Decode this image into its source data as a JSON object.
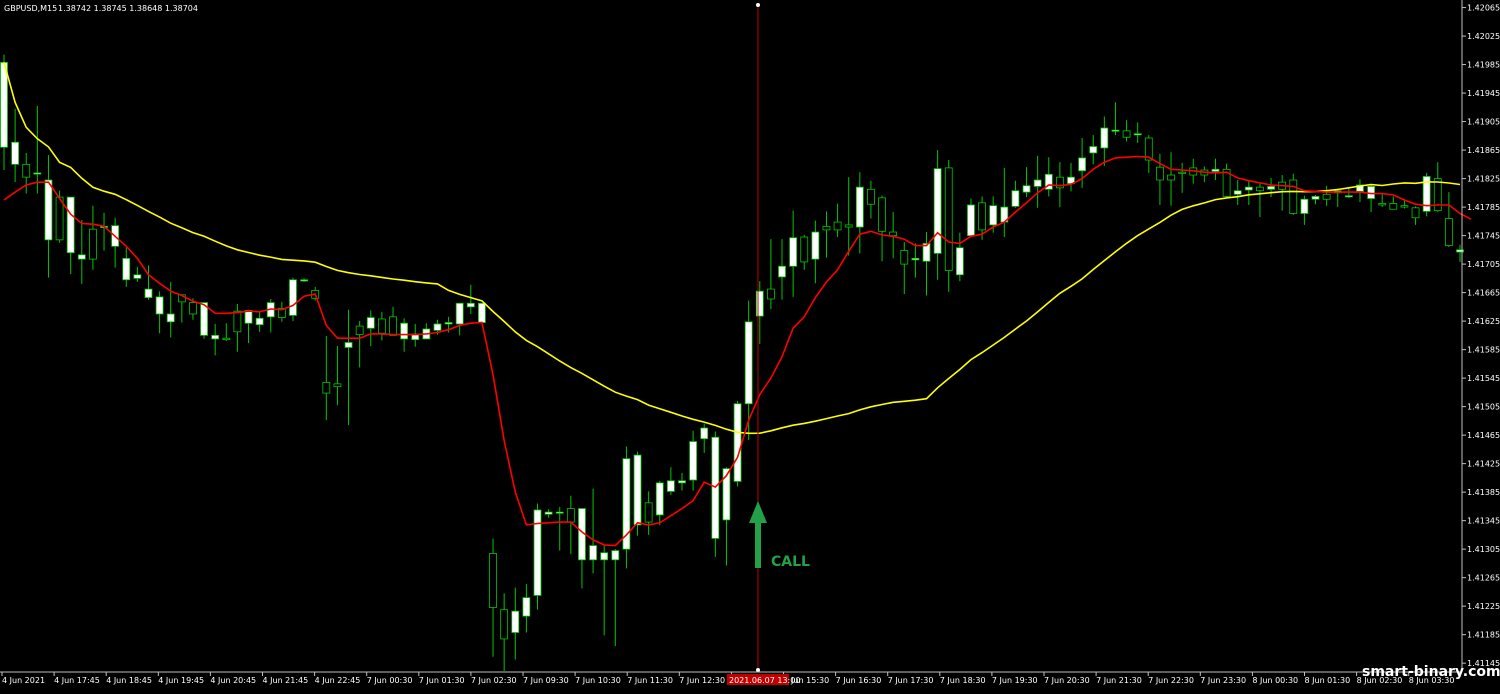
{
  "header": {
    "symbol": "GBPUSD,M15",
    "quotes": "1.38742 1.38745 1.38648 1.38704"
  },
  "watermark": "smart-binary.com",
  "signal": {
    "label": "CALL",
    "color": "#24a148"
  },
  "cursor_time_label": "2021.06.07 13:00",
  "colors": {
    "background": "#000000",
    "axis": "#c0c0c0",
    "candle_wick": "#00c800",
    "candle_bull": "#ffffff",
    "candle_bear": "#000000",
    "fast_ma": "#ff0000",
    "slow_ma": "#ffff00",
    "cursor": "#c00000"
  },
  "chart_data": {
    "type": "candlestick",
    "title": "",
    "y_ticks": [
      "1.42065",
      "1.42025",
      "1.41985",
      "1.41945",
      "1.41905",
      "1.41865",
      "1.41825",
      "1.41785",
      "1.41745",
      "1.41705",
      "1.41665",
      "1.41625",
      "1.41585",
      "1.41545",
      "1.41505",
      "1.41465",
      "1.41425",
      "1.41385",
      "1.41345",
      "1.41305",
      "1.41265",
      "1.41225",
      "1.41185",
      "1.41145"
    ],
    "ylim": [
      1.41134,
      1.4207
    ],
    "x_ticks": [
      "4 Jun 2021",
      "4 Jun 17:45",
      "4 Jun 18:45",
      "4 Jun 19:45",
      "4 Jun 20:45",
      "4 Jun 21:45",
      "4 Jun 22:45",
      "7 Jun 00:30",
      "7 Jun 01:30",
      "7 Jun 02:30",
      "7 Jun 09:30",
      "7 Jun 10:30",
      "7 Jun 11:30",
      "7 Jun 12:30",
      "7 Jun 14:30",
      "7 Jun 15:30",
      "7 Jun 16:30",
      "7 Jun 17:30",
      "7 Jun 18:30",
      "7 Jun 19:30",
      "7 Jun 20:30",
      "7 Jun 21:30",
      "7 Jun 22:30",
      "7 Jun 23:30",
      "8 Jun 00:30",
      "8 Jun 01:30",
      "8 Jun 02:30",
      "8 Jun 03:30"
    ],
    "candles": [
      {
        "o": 1.41869,
        "h": 1.41999,
        "l": 1.41837,
        "c": 1.41988
      },
      {
        "o": 1.41845,
        "h": 1.41923,
        "l": 1.4182,
        "c": 1.41876
      },
      {
        "o": 1.41845,
        "h": 1.41861,
        "l": 1.41804,
        "c": 1.41827
      },
      {
        "o": 1.41833,
        "h": 1.41927,
        "l": 1.41804,
        "c": 1.41833
      },
      {
        "o": 1.41739,
        "h": 1.41858,
        "l": 1.41686,
        "c": 1.41823
      },
      {
        "o": 1.41799,
        "h": 1.41808,
        "l": 1.41735,
        "c": 1.41739
      },
      {
        "o": 1.41721,
        "h": 1.41799,
        "l": 1.41691,
        "c": 1.41799
      },
      {
        "o": 1.41712,
        "h": 1.41767,
        "l": 1.41677,
        "c": 1.41718
      },
      {
        "o": 1.41754,
        "h": 1.41787,
        "l": 1.41697,
        "c": 1.41712
      },
      {
        "o": 1.41758,
        "h": 1.41777,
        "l": 1.41724,
        "c": 1.41758
      },
      {
        "o": 1.4173,
        "h": 1.4177,
        "l": 1.417,
        "c": 1.41759
      },
      {
        "o": 1.41683,
        "h": 1.41728,
        "l": 1.41673,
        "c": 1.41713
      },
      {
        "o": 1.41685,
        "h": 1.41701,
        "l": 1.4168,
        "c": 1.4169
      },
      {
        "o": 1.41658,
        "h": 1.41703,
        "l": 1.41655,
        "c": 1.4167
      },
      {
        "o": 1.41635,
        "h": 1.41667,
        "l": 1.41608,
        "c": 1.41659
      },
      {
        "o": 1.41624,
        "h": 1.4168,
        "l": 1.41602,
        "c": 1.41635
      },
      {
        "o": 1.41662,
        "h": 1.41662,
        "l": 1.41623,
        "c": 1.41652
      },
      {
        "o": 1.41651,
        "h": 1.41657,
        "l": 1.41627,
        "c": 1.41635
      },
      {
        "o": 1.41605,
        "h": 1.41647,
        "l": 1.416,
        "c": 1.41651
      },
      {
        "o": 1.416,
        "h": 1.41621,
        "l": 1.41577,
        "c": 1.41605
      },
      {
        "o": 1.41601,
        "h": 1.41622,
        "l": 1.41597,
        "c": 1.41599
      },
      {
        "o": 1.41639,
        "h": 1.41649,
        "l": 1.41582,
        "c": 1.4161
      },
      {
        "o": 1.41622,
        "h": 1.41641,
        "l": 1.41594,
        "c": 1.4164
      },
      {
        "o": 1.4162,
        "h": 1.41639,
        "l": 1.4161,
        "c": 1.41629
      },
      {
        "o": 1.41631,
        "h": 1.41656,
        "l": 1.41609,
        "c": 1.41651
      },
      {
        "o": 1.41643,
        "h": 1.41652,
        "l": 1.41624,
        "c": 1.4163
      },
      {
        "o": 1.41633,
        "h": 1.41686,
        "l": 1.41625,
        "c": 1.41683
      },
      {
        "o": 1.41683,
        "h": 1.41685,
        "l": 1.4168,
        "c": 1.41683
      },
      {
        "o": 1.41668,
        "h": 1.41673,
        "l": 1.41654,
        "c": 1.41657
      },
      {
        "o": 1.41539,
        "h": 1.41604,
        "l": 1.41486,
        "c": 1.41524
      },
      {
        "o": 1.41537,
        "h": 1.4159,
        "l": 1.41507,
        "c": 1.41533
      },
      {
        "o": 1.41588,
        "h": 1.41641,
        "l": 1.41479,
        "c": 1.41595
      },
      {
        "o": 1.41618,
        "h": 1.41625,
        "l": 1.4156,
        "c": 1.41606
      },
      {
        "o": 1.41615,
        "h": 1.4164,
        "l": 1.4159,
        "c": 1.4163
      },
      {
        "o": 1.41628,
        "h": 1.41638,
        "l": 1.41598,
        "c": 1.41608
      },
      {
        "o": 1.41631,
        "h": 1.41645,
        "l": 1.41613,
        "c": 1.41605
      },
      {
        "o": 1.416,
        "h": 1.41629,
        "l": 1.41582,
        "c": 1.41622
      },
      {
        "o": 1.41599,
        "h": 1.41621,
        "l": 1.41589,
        "c": 1.41607
      },
      {
        "o": 1.416,
        "h": 1.41622,
        "l": 1.41602,
        "c": 1.41614
      },
      {
        "o": 1.41612,
        "h": 1.41627,
        "l": 1.41606,
        "c": 1.41621
      },
      {
        "o": 1.41621,
        "h": 1.41631,
        "l": 1.41609,
        "c": 1.41623
      },
      {
        "o": 1.41621,
        "h": 1.41649,
        "l": 1.41605,
        "c": 1.4165
      },
      {
        "o": 1.41645,
        "h": 1.41676,
        "l": 1.41635,
        "c": 1.4165
      },
      {
        "o": 1.41623,
        "h": 1.41648,
        "l": 1.41623,
        "c": 1.4165
      },
      {
        "o": 1.41299,
        "h": 1.4132,
        "l": 1.41154,
        "c": 1.41223
      },
      {
        "o": 1.4122,
        "h": 1.41243,
        "l": 1.41134,
        "c": 1.41179
      },
      {
        "o": 1.41188,
        "h": 1.41251,
        "l": 1.4115,
        "c": 1.41218
      },
      {
        "o": 1.41211,
        "h": 1.41256,
        "l": 1.41188,
        "c": 1.41237
      },
      {
        "o": 1.4124,
        "h": 1.41369,
        "l": 1.4122,
        "c": 1.4136
      },
      {
        "o": 1.41354,
        "h": 1.41361,
        "l": 1.41349,
        "c": 1.41357
      },
      {
        "o": 1.41356,
        "h": 1.41364,
        "l": 1.41303,
        "c": 1.41357
      },
      {
        "o": 1.41362,
        "h": 1.4138,
        "l": 1.41298,
        "c": 1.41343
      },
      {
        "o": 1.4129,
        "h": 1.41362,
        "l": 1.4125,
        "c": 1.41362
      },
      {
        "o": 1.4129,
        "h": 1.4139,
        "l": 1.41271,
        "c": 1.4131
      },
      {
        "o": 1.4129,
        "h": 1.4131,
        "l": 1.41184,
        "c": 1.413
      },
      {
        "o": 1.4129,
        "h": 1.41305,
        "l": 1.41169,
        "c": 1.41303
      },
      {
        "o": 1.41305,
        "h": 1.41449,
        "l": 1.41278,
        "c": 1.41432
      },
      {
        "o": 1.41339,
        "h": 1.41442,
        "l": 1.41324,
        "c": 1.41437
      },
      {
        "o": 1.4137,
        "h": 1.41386,
        "l": 1.41325,
        "c": 1.41343
      },
      {
        "o": 1.41353,
        "h": 1.41401,
        "l": 1.41339,
        "c": 1.41398
      },
      {
        "o": 1.41386,
        "h": 1.4142,
        "l": 1.41381,
        "c": 1.41401
      },
      {
        "o": 1.41398,
        "h": 1.41412,
        "l": 1.41387,
        "c": 1.41401
      },
      {
        "o": 1.41402,
        "h": 1.41471,
        "l": 1.41387,
        "c": 1.41456
      },
      {
        "o": 1.4146,
        "h": 1.41481,
        "l": 1.4144,
        "c": 1.41475
      },
      {
        "o": 1.4132,
        "h": 1.4147,
        "l": 1.41294,
        "c": 1.41462
      },
      {
        "o": 1.41346,
        "h": 1.4142,
        "l": 1.41282,
        "c": 1.41418
      },
      {
        "o": 1.414,
        "h": 1.41513,
        "l": 1.41393,
        "c": 1.41509
      },
      {
        "o": 1.41509,
        "h": 1.41654,
        "l": 1.41458,
        "c": 1.41624
      },
      {
        "o": 1.41632,
        "h": 1.41681,
        "l": 1.41593,
        "c": 1.41667
      },
      {
        "o": 1.4167,
        "h": 1.4174,
        "l": 1.41642,
        "c": 1.41656
      },
      {
        "o": 1.41687,
        "h": 1.4174,
        "l": 1.41655,
        "c": 1.41702
      },
      {
        "o": 1.41702,
        "h": 1.4178,
        "l": 1.41659,
        "c": 1.41742
      },
      {
        "o": 1.41743,
        "h": 1.41746,
        "l": 1.41697,
        "c": 1.41708
      },
      {
        "o": 1.41712,
        "h": 1.41766,
        "l": 1.41678,
        "c": 1.4175
      },
      {
        "o": 1.41758,
        "h": 1.41779,
        "l": 1.41714,
        "c": 1.41753
      },
      {
        "o": 1.41764,
        "h": 1.4179,
        "l": 1.41743,
        "c": 1.41753
      },
      {
        "o": 1.4176,
        "h": 1.41827,
        "l": 1.41717,
        "c": 1.41757
      },
      {
        "o": 1.41757,
        "h": 1.41834,
        "l": 1.4172,
        "c": 1.41813
      },
      {
        "o": 1.4181,
        "h": 1.41822,
        "l": 1.41769,
        "c": 1.41789
      },
      {
        "o": 1.41798,
        "h": 1.41801,
        "l": 1.41709,
        "c": 1.41751
      },
      {
        "o": 1.4175,
        "h": 1.41778,
        "l": 1.41713,
        "c": 1.41745
      },
      {
        "o": 1.41724,
        "h": 1.41736,
        "l": 1.41663,
        "c": 1.41705
      },
      {
        "o": 1.41711,
        "h": 1.41734,
        "l": 1.41686,
        "c": 1.41713
      },
      {
        "o": 1.41709,
        "h": 1.4175,
        "l": 1.41661,
        "c": 1.41734
      },
      {
        "o": 1.4172,
        "h": 1.41865,
        "l": 1.41683,
        "c": 1.41839
      },
      {
        "o": 1.4184,
        "h": 1.41851,
        "l": 1.41666,
        "c": 1.41696
      },
      {
        "o": 1.4169,
        "h": 1.41749,
        "l": 1.41681,
        "c": 1.41728
      },
      {
        "o": 1.41745,
        "h": 1.41797,
        "l": 1.41744,
        "c": 1.41788
      },
      {
        "o": 1.41791,
        "h": 1.418,
        "l": 1.41739,
        "c": 1.41753
      },
      {
        "o": 1.4176,
        "h": 1.418,
        "l": 1.41749,
        "c": 1.41787
      },
      {
        "o": 1.41764,
        "h": 1.4184,
        "l": 1.41743,
        "c": 1.41785
      },
      {
        "o": 1.41786,
        "h": 1.41822,
        "l": 1.41784,
        "c": 1.41808
      },
      {
        "o": 1.41806,
        "h": 1.41841,
        "l": 1.41799,
        "c": 1.41815
      },
      {
        "o": 1.41814,
        "h": 1.41857,
        "l": 1.41784,
        "c": 1.41823
      },
      {
        "o": 1.4181,
        "h": 1.41855,
        "l": 1.418,
        "c": 1.41831
      },
      {
        "o": 1.41827,
        "h": 1.41848,
        "l": 1.41785,
        "c": 1.41812
      },
      {
        "o": 1.41818,
        "h": 1.41847,
        "l": 1.41807,
        "c": 1.41827
      },
      {
        "o": 1.41836,
        "h": 1.41882,
        "l": 1.41812,
        "c": 1.41854
      },
      {
        "o": 1.41861,
        "h": 1.41886,
        "l": 1.41845,
        "c": 1.4187
      },
      {
        "o": 1.41868,
        "h": 1.41912,
        "l": 1.41843,
        "c": 1.41896
      },
      {
        "o": 1.41892,
        "h": 1.41932,
        "l": 1.41886,
        "c": 1.41893
      },
      {
        "o": 1.41892,
        "h": 1.41907,
        "l": 1.41877,
        "c": 1.41883
      },
      {
        "o": 1.41888,
        "h": 1.41904,
        "l": 1.41875,
        "c": 1.41888
      },
      {
        "o": 1.41882,
        "h": 1.41886,
        "l": 1.41833,
        "c": 1.41851
      },
      {
        "o": 1.41841,
        "h": 1.4186,
        "l": 1.41788,
        "c": 1.41823
      },
      {
        "o": 1.4183,
        "h": 1.41862,
        "l": 1.41787,
        "c": 1.41823
      },
      {
        "o": 1.41834,
        "h": 1.41847,
        "l": 1.41805,
        "c": 1.41833
      },
      {
        "o": 1.4184,
        "h": 1.41853,
        "l": 1.41818,
        "c": 1.4183
      },
      {
        "o": 1.41837,
        "h": 1.41842,
        "l": 1.4182,
        "c": 1.4183
      },
      {
        "o": 1.41835,
        "h": 1.41853,
        "l": 1.41823,
        "c": 1.41838
      },
      {
        "o": 1.41838,
        "h": 1.41846,
        "l": 1.41799,
        "c": 1.418
      },
      {
        "o": 1.41803,
        "h": 1.41823,
        "l": 1.41788,
        "c": 1.41808
      },
      {
        "o": 1.41809,
        "h": 1.41822,
        "l": 1.41788,
        "c": 1.41813
      },
      {
        "o": 1.41813,
        "h": 1.41818,
        "l": 1.41771,
        "c": 1.41808
      },
      {
        "o": 1.4181,
        "h": 1.41826,
        "l": 1.41799,
        "c": 1.41814
      },
      {
        "o": 1.4182,
        "h": 1.4183,
        "l": 1.4178,
        "c": 1.4181
      },
      {
        "o": 1.41823,
        "h": 1.41832,
        "l": 1.41774,
        "c": 1.41776
      },
      {
        "o": 1.41776,
        "h": 1.41801,
        "l": 1.4176,
        "c": 1.41796
      },
      {
        "o": 1.41796,
        "h": 1.41802,
        "l": 1.41789,
        "c": 1.418
      },
      {
        "o": 1.41803,
        "h": 1.41815,
        "l": 1.41787,
        "c": 1.41796
      },
      {
        "o": 1.41805,
        "h": 1.41811,
        "l": 1.41785,
        "c": 1.41808
      },
      {
        "o": 1.418,
        "h": 1.41813,
        "l": 1.41798,
        "c": 1.41801
      },
      {
        "o": 1.41807,
        "h": 1.41824,
        "l": 1.41792,
        "c": 1.41816
      },
      {
        "o": 1.41797,
        "h": 1.41816,
        "l": 1.41778,
        "c": 1.41814
      },
      {
        "o": 1.4179,
        "h": 1.41803,
        "l": 1.41785,
        "c": 1.41788
      },
      {
        "o": 1.4179,
        "h": 1.418,
        "l": 1.41785,
        "c": 1.41782
      },
      {
        "o": 1.41787,
        "h": 1.41796,
        "l": 1.41783,
        "c": 1.41785
      },
      {
        "o": 1.41784,
        "h": 1.41786,
        "l": 1.4176,
        "c": 1.4177
      },
      {
        "o": 1.41779,
        "h": 1.41833,
        "l": 1.41772,
        "c": 1.41828
      },
      {
        "o": 1.41825,
        "h": 1.41848,
        "l": 1.41778,
        "c": 1.4178
      },
      {
        "o": 1.41769,
        "h": 1.41806,
        "l": 1.41729,
        "c": 1.41731
      },
      {
        "o": 1.41722,
        "h": 1.41732,
        "l": 1.41708,
        "c": 1.41725
      }
    ],
    "fast_ma": [
      1.41795,
      1.41806,
      1.41816,
      1.4182,
      1.4182,
      1.41797,
      1.41775,
      1.41762,
      1.41761,
      1.41758,
      1.41744,
      1.4173,
      1.41713,
      1.4169,
      1.41678,
      1.41667,
      1.41661,
      1.41653,
      1.41648,
      1.41636,
      1.41636,
      1.41637,
      1.41639,
      1.41638,
      1.41642,
      1.41641,
      1.41647,
      1.4166,
      1.41663,
      1.41619,
      1.41601,
      1.41601,
      1.41601,
      1.41607,
      1.41607,
      1.41606,
      1.41606,
      1.41606,
      1.41607,
      1.41609,
      1.41613,
      1.41619,
      1.41622,
      1.41623,
      1.4155,
      1.41457,
      1.41385,
      1.41339,
      1.41341,
      1.41342,
      1.41343,
      1.41343,
      1.41329,
      1.41318,
      1.41311,
      1.4131,
      1.41325,
      1.41342,
      1.41339,
      1.41342,
      1.41352,
      1.41362,
      1.41373,
      1.41399,
      1.41392,
      1.41408,
      1.41434,
      1.41486,
      1.41522,
      1.41545,
      1.41575,
      1.41615,
      1.41631,
      1.41658,
      1.4168,
      1.41697,
      1.41723,
      1.41747,
      1.41751,
      1.41746,
      1.41744,
      1.4174,
      1.41731,
      1.41731,
      1.41749,
      1.41736,
      1.41734,
      1.41744,
      1.41747,
      1.41757,
      1.41764,
      1.41778,
      1.41791,
      1.41805,
      1.41816,
      1.41815,
      1.41817,
      1.41825,
      1.41838,
      1.41848,
      1.41854,
      1.41855,
      1.41856,
      1.41855,
      1.41846,
      1.41838,
      1.41837,
      1.41836,
      1.41834,
      1.41833,
      1.41834,
      1.41826,
      1.41822,
      1.41819,
      1.41816,
      1.41815,
      1.41814,
      1.41808,
      1.41807,
      1.41806,
      1.41806,
      1.41806,
      1.41806,
      1.41804,
      1.41804,
      1.41802,
      1.41795,
      1.41789,
      1.41787,
      1.41788,
      1.41788,
      1.41776,
      1.41768
    ]
  }
}
